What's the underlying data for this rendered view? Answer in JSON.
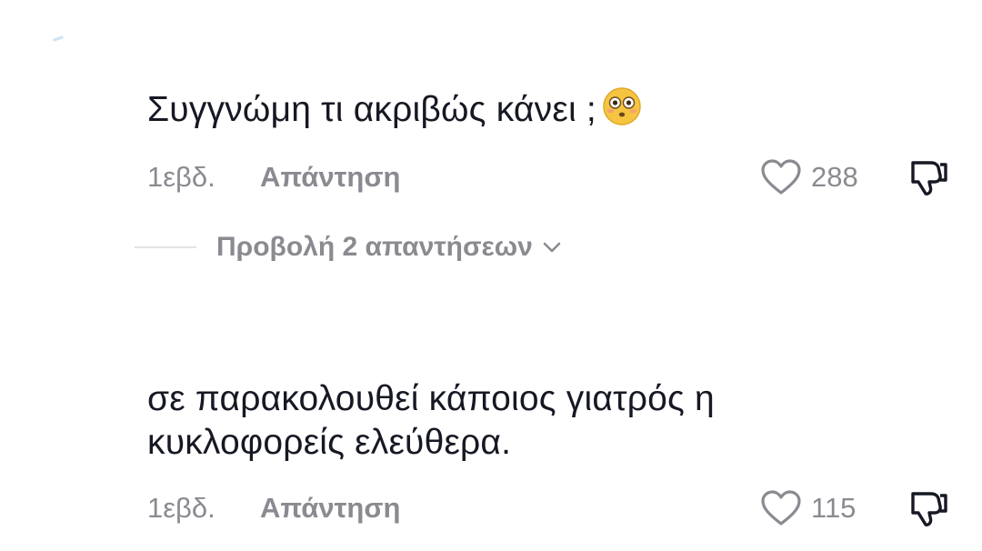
{
  "comments": [
    {
      "text": "Συγγνώμη τι ακριβώς κάνει ;",
      "emoji": "flushed-face-emoji",
      "time": "1εβδ.",
      "reply_label": "Απάντηση",
      "likes": "288"
    },
    {
      "text": "σε παρακολουθεί κάποιος γιατρός η\nκυκλοφορείς ελεύθερα.",
      "time": "1εβδ.",
      "reply_label": "Απάντηση",
      "likes": "115"
    }
  ],
  "replies_toggle": {
    "label": "Προβολή 2 απαντήσεων",
    "icon": "chevron-down-icon"
  },
  "colors": {
    "text": "#161823",
    "muted": "#8a8b91",
    "divider": "#e3e3e6",
    "emoji_face": "#f5c542"
  },
  "icons": {
    "like": "heart-outline-icon",
    "dislike": "thumbs-down-outline-icon"
  }
}
